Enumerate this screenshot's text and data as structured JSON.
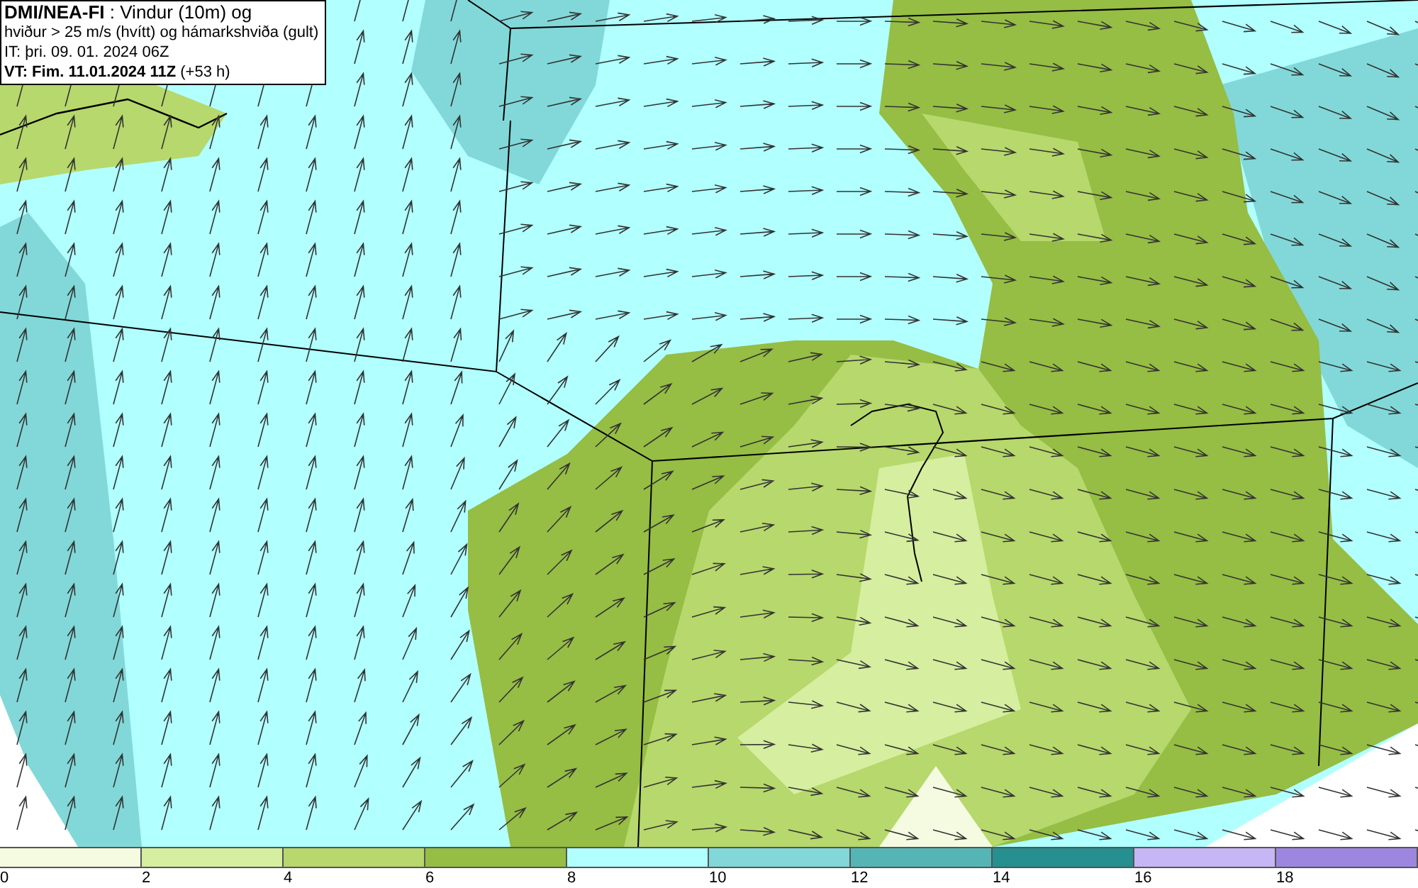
{
  "title_box": {
    "lines": [
      "**DMI/NEA-FI** : Vindur (10m) og",
      "hviður > 25 m/s (hvítt) og hámarkshviða (gult)",
      "IT: þri. 09. 01. 2024 06Z",
      "**VT: Fim. 11.01.2024 11Z** (+53 h)"
    ]
  },
  "legend": {
    "bins": [
      {
        "color": "#f4fbe0",
        "label": "0"
      },
      {
        "color": "#d5ee9f",
        "label": "2"
      },
      {
        "color": "#b6d86c",
        "label": "4"
      },
      {
        "color": "#96bd44",
        "label": "6"
      },
      {
        "color": "#b1ffff",
        "label": "8"
      },
      {
        "color": "#82d8d8",
        "label": "10"
      },
      {
        "color": "#55b5b5",
        "label": "12"
      },
      {
        "color": "#268f8f",
        "label": "14"
      },
      {
        "color": "#c6b6f6",
        "label": "16"
      },
      {
        "color": "#9d86e0",
        "label": "18"
      }
    ]
  }
}
